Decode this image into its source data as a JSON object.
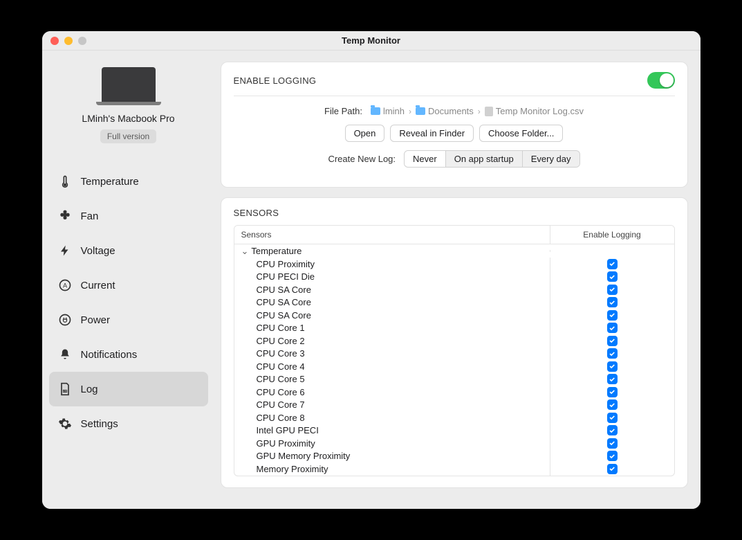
{
  "window": {
    "title": "Temp Monitor"
  },
  "device": {
    "name": "LMinh's Macbook Pro",
    "version_label": "Full version"
  },
  "sidebar": {
    "items": [
      {
        "id": "temperature",
        "label": "Temperature",
        "icon": "thermometer-icon"
      },
      {
        "id": "fan",
        "label": "Fan",
        "icon": "fan-icon"
      },
      {
        "id": "voltage",
        "label": "Voltage",
        "icon": "bolt-icon"
      },
      {
        "id": "current",
        "label": "Current",
        "icon": "amp-icon"
      },
      {
        "id": "power",
        "label": "Power",
        "icon": "plug-icon"
      },
      {
        "id": "notifications",
        "label": "Notifications",
        "icon": "bell-icon"
      },
      {
        "id": "log",
        "label": "Log",
        "icon": "log-icon"
      },
      {
        "id": "settings",
        "label": "Settings",
        "icon": "gear-icon"
      }
    ],
    "selected": "log"
  },
  "logging_panel": {
    "title": "ENABLE LOGGING",
    "enabled": true,
    "file_path_label": "File Path:",
    "path": [
      {
        "type": "folder",
        "label": "lminh"
      },
      {
        "type": "folder",
        "label": "Documents"
      },
      {
        "type": "file",
        "label": "Temp Monitor Log.csv"
      }
    ],
    "buttons": {
      "open": "Open",
      "reveal": "Reveal in Finder",
      "choose": "Choose Folder..."
    },
    "create_new_log_label": "Create New Log:",
    "create_options": [
      {
        "label": "Never",
        "active": true
      },
      {
        "label": "On app startup",
        "active": false
      },
      {
        "label": "Every day",
        "active": false
      }
    ]
  },
  "sensors_panel": {
    "title": "SENSORS",
    "columns": {
      "name": "Sensors",
      "enable": "Enable Logging"
    },
    "group_name": "Temperature",
    "rows": [
      {
        "name": "CPU Proximity",
        "enabled": true
      },
      {
        "name": "CPU PECI Die",
        "enabled": true
      },
      {
        "name": "CPU SA Core",
        "enabled": true
      },
      {
        "name": "CPU SA Core",
        "enabled": true
      },
      {
        "name": "CPU SA Core",
        "enabled": true
      },
      {
        "name": "CPU Core 1",
        "enabled": true
      },
      {
        "name": "CPU Core 2",
        "enabled": true
      },
      {
        "name": "CPU Core 3",
        "enabled": true
      },
      {
        "name": "CPU Core 4",
        "enabled": true
      },
      {
        "name": "CPU Core 5",
        "enabled": true
      },
      {
        "name": "CPU Core 6",
        "enabled": true
      },
      {
        "name": "CPU Core 7",
        "enabled": true
      },
      {
        "name": "CPU Core 8",
        "enabled": true
      },
      {
        "name": "Intel GPU PECI",
        "enabled": true
      },
      {
        "name": "GPU Proximity",
        "enabled": true
      },
      {
        "name": "GPU Memory Proximity",
        "enabled": true
      },
      {
        "name": "Memory Proximity",
        "enabled": true
      }
    ]
  }
}
